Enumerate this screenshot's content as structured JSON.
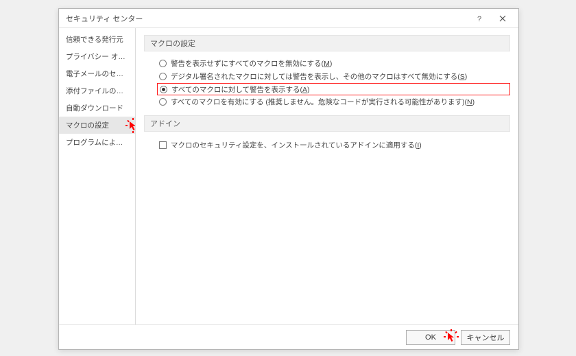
{
  "dialog": {
    "title": "セキュリティ センター",
    "help_tooltip": "?",
    "close_tooltip": "×"
  },
  "sidebar": {
    "items": [
      {
        "label": "信頼できる発行元"
      },
      {
        "label": "プライバシー オプション"
      },
      {
        "label": "電子メールのセキュリティ"
      },
      {
        "label": "添付ファイルの取り扱い"
      },
      {
        "label": "自動ダウンロード"
      },
      {
        "label": "マクロの設定"
      },
      {
        "label": "プログラムによるアクセス"
      }
    ],
    "selected_index": 5
  },
  "content": {
    "macro": {
      "section_title": "マクロの設定",
      "options": [
        {
          "label_pre": "警告を表示せずにすべてのマクロを無効にする(",
          "hotkey": "M",
          "label_post": ")"
        },
        {
          "label_pre": "デジタル署名されたマクロに対しては警告を表示し、その他のマクロはすべて無効にする(",
          "hotkey": "S",
          "label_post": ")"
        },
        {
          "label_pre": "すべてのマクロに対して警告を表示する(",
          "hotkey": "A",
          "label_post": ")"
        },
        {
          "label_pre": "すべてのマクロを有効にする (推奨しません。危険なコードが実行される可能性があります)(",
          "hotkey": "N",
          "label_post": ")"
        }
      ],
      "selected_index": 2
    },
    "addin": {
      "section_title": "アドイン",
      "checkbox_label_pre": "マクロのセキュリティ設定を、インストールされているアドインに適用する(",
      "checkbox_hotkey": "I",
      "checkbox_label_post": ")",
      "checked": false
    }
  },
  "footer": {
    "ok_label": "OK",
    "cancel_label": "キャンセル"
  }
}
